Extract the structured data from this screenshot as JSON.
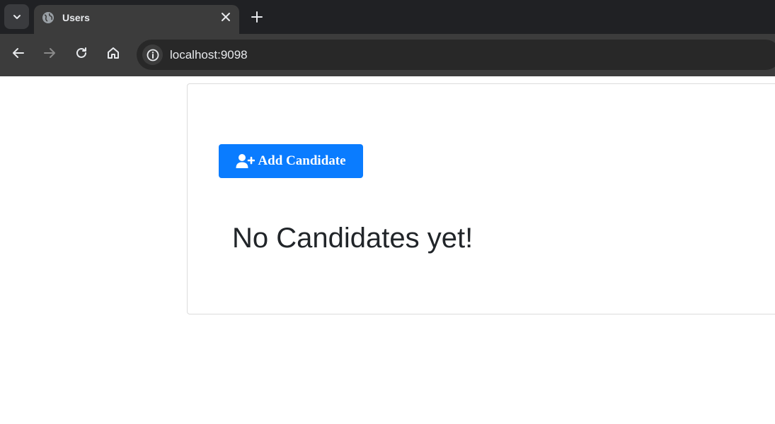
{
  "browser": {
    "tab": {
      "title": "Users"
    },
    "address_bar": {
      "url": "localhost:9098"
    }
  },
  "page": {
    "add_button_label": "Add Candidate",
    "empty_message": "No Candidates yet!"
  },
  "colors": {
    "primary": "#0a7cff",
    "text": "#212529",
    "chrome_dark": "#202124",
    "chrome_toolbar": "#3c3c3c"
  },
  "icons": [
    "chevron-down-icon",
    "globe-icon",
    "close-icon",
    "plus-icon",
    "back-arrow-icon",
    "forward-arrow-icon",
    "reload-icon",
    "home-icon",
    "info-icon",
    "user-plus-icon"
  ]
}
